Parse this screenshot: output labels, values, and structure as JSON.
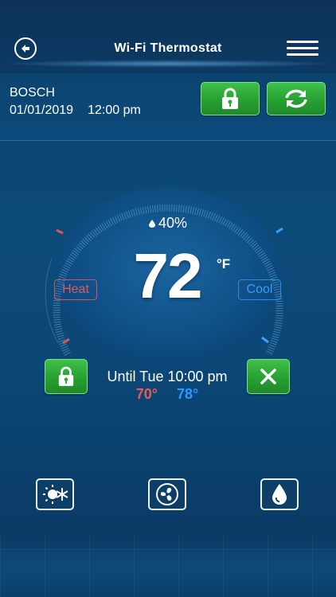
{
  "header": {
    "title": "Wi-Fi Thermostat",
    "back_icon": "back-arrow-icon",
    "menu_icon": "hamburger-menu-icon"
  },
  "device": {
    "brand": "BOSCH",
    "date": "01/01/2019",
    "time": "12:00 pm",
    "lock_icon": "padlock-icon",
    "sync_icon": "sync-icon"
  },
  "thermostat": {
    "humidity": "40%",
    "temperature": "72",
    "unit": "°F",
    "heat_label": "Heat",
    "cool_label": "Cool"
  },
  "hold": {
    "until_text": "Until Tue 10:00 pm",
    "heat_setpoint": "70°",
    "cool_setpoint": "78°",
    "lock_icon": "padlock-icon",
    "cancel_icon": "close-icon"
  },
  "modes": [
    {
      "icon": "sun-snowflake-icon"
    },
    {
      "icon": "fan-icon"
    },
    {
      "icon": "water-drop-icon"
    }
  ],
  "colors": {
    "accent_green": "#2aa834",
    "heat_red": "#e05a62",
    "cool_blue": "#2e98ff",
    "background": "#0c4a78"
  }
}
